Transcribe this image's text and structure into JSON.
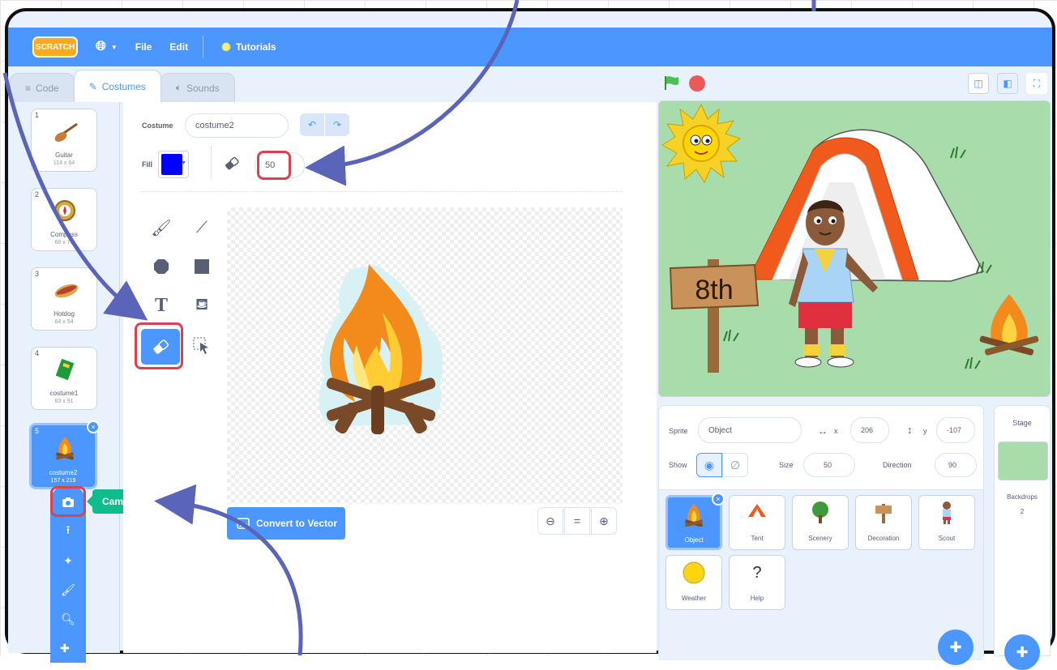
{
  "menubar": {
    "logo": "SCRATCH",
    "file": "File",
    "edit": "Edit",
    "tutorials": "Tutorials"
  },
  "tabs": {
    "code": "Code",
    "costumes": "Costumes",
    "sounds": "Sounds"
  },
  "costumes": [
    {
      "num": "1",
      "name": "Guitar",
      "size": "114 x 64",
      "icon": "guitar-icon"
    },
    {
      "num": "2",
      "name": "Compass",
      "size": "68 x 71",
      "icon": "compass-icon"
    },
    {
      "num": "3",
      "name": "Hotdog",
      "size": "64 x 54",
      "icon": "hotdog-icon"
    },
    {
      "num": "4",
      "name": "costume1",
      "size": "83 x 91",
      "icon": "book-icon"
    },
    {
      "num": "5",
      "name": "costume2",
      "size": "157 x 219",
      "icon": "campfire-icon"
    }
  ],
  "camera_tooltip": "Camera",
  "editor": {
    "costume_label": "Costume",
    "costume_name": "costume2",
    "fill_label": "Fill",
    "fill_color": "#0000ff",
    "eraser_size": "50",
    "convert_label": "Convert to Vector"
  },
  "stage": {
    "sign_text": "8th",
    "accent": "#4c97ff"
  },
  "sprite_info": {
    "sprite_label": "Sprite",
    "sprite_name": "Object",
    "x_label": "x",
    "x": "206",
    "y_label": "y",
    "y": "-107",
    "show_label": "Show",
    "size_label": "Size",
    "size": "50",
    "direction_label": "Direction",
    "direction": "90"
  },
  "sprites": [
    {
      "name": "Object",
      "icon": "campfire-icon"
    },
    {
      "name": "Tent",
      "icon": "tent-icon"
    },
    {
      "name": "Scenery",
      "icon": "tree-icon"
    },
    {
      "name": "Decoration",
      "icon": "sign-icon"
    },
    {
      "name": "Scout",
      "icon": "scout-icon"
    },
    {
      "name": "Weather",
      "icon": "sun-icon"
    },
    {
      "name": "Help",
      "icon": "question-icon"
    }
  ],
  "stage_pane": {
    "label": "Stage",
    "backdrops_label": "Backdrops",
    "backdrops_count": "2"
  }
}
